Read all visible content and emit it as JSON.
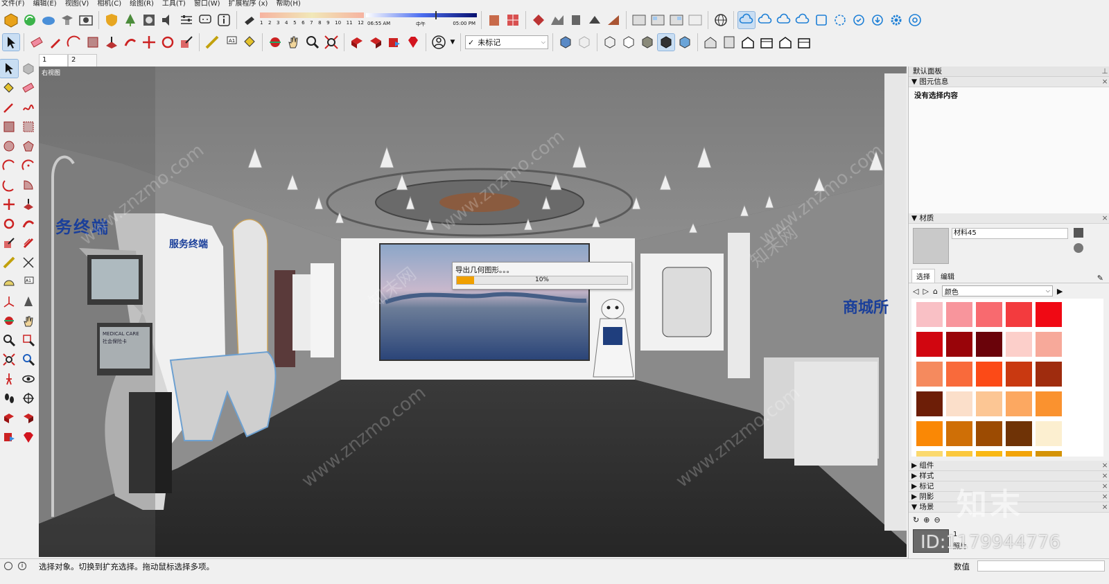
{
  "menu": [
    "文件(F)",
    "编辑(E)",
    "视图(V)",
    "相机(C)",
    "绘图(R)",
    "工具(T)",
    "窗口(W)",
    "扩展程序 (x)",
    "帮助(H)"
  ],
  "shadow_slider": {
    "months": [
      "1",
      "2",
      "3",
      "4",
      "5",
      "6",
      "7",
      "8",
      "9",
      "10",
      "11",
      "12"
    ],
    "time_start": "06:55 AM",
    "time_mid": "中午",
    "time_end": "05:00 PM"
  },
  "tag_select": {
    "check": "✓",
    "value": "未标记"
  },
  "scene_tabs": [
    "1",
    "2"
  ],
  "viewport": {
    "panel_label": "右视图",
    "left_sign": "务终端",
    "mid_sign": "服务终端",
    "right_sign": "商城所",
    "kiosk_caption": "MEDICAL CARE",
    "kiosk_subcaption": "社会保险卡",
    "watermark": "www.znzmo.com",
    "watermark_cn": "知末网"
  },
  "progress": {
    "title": "导出几何图形。。。",
    "percent_label": "10%",
    "fraction": 0.1,
    "fill_color": "#f0a000"
  },
  "panel": {
    "title": "默认面板",
    "entity_info": {
      "label": "图元信息",
      "empty_text": "没有选择内容"
    },
    "materials": {
      "label": "材质",
      "current_name": "材料45",
      "tab_select": "选择",
      "tab_edit": "编辑",
      "library": "颜色",
      "swatches": [
        "#f9c0c5",
        "#f8959c",
        "#f86a6f",
        "#f33b3e",
        "#f00914",
        "#d10610",
        "#990409",
        "#6a030a",
        "#fccfca",
        "#f7a99a",
        "#f58a5e",
        "#f96a3b",
        "#fc4a17",
        "#c93911",
        "#9f2c0e",
        "#6d1e07",
        "#fbdfca",
        "#fcc694",
        "#fca861",
        "#fa922f",
        "#fa8805",
        "#cf6f06",
        "#9c4b02",
        "#6f3306",
        "#fcefd0"
      ],
      "partial_row": [
        "#fbd96e",
        "#fbc83d",
        "#f9b815",
        "#f2a409",
        "#d49306"
      ]
    },
    "sections": [
      "组件",
      "样式",
      "标记",
      "阴影",
      "场景"
    ],
    "scene_thumb_label": "1",
    "scene_thumb_name": "照片"
  },
  "status": {
    "text": "选择对象。切换到扩充选择。拖动鼠标选择多项。",
    "measure_label": "数值"
  },
  "id_overlay": "ID:1179944776",
  "zn_logo": "知末",
  "accent": "#1d7fd6"
}
